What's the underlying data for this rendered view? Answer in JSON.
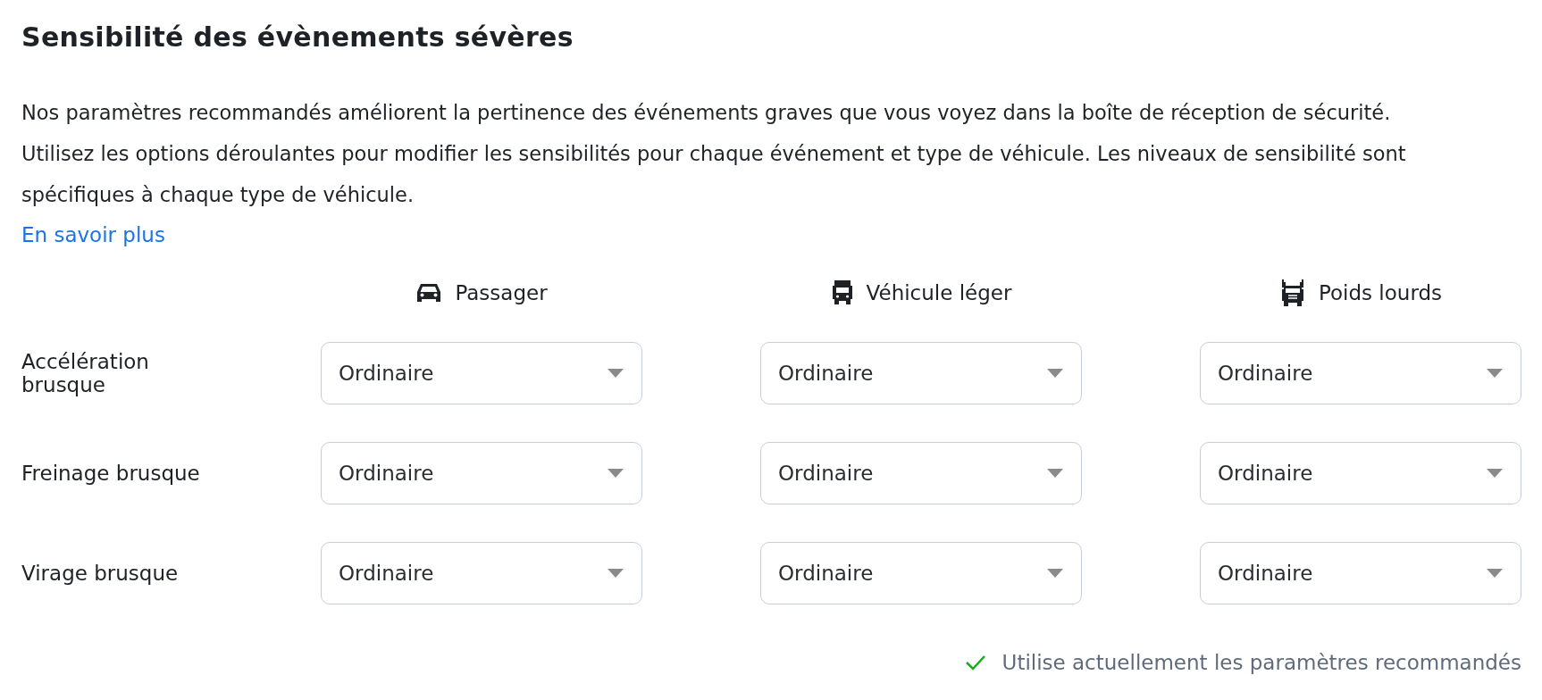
{
  "title": "Sensibilité des évènements sévères",
  "description": "Nos paramètres recommandés améliorent la pertinence des événements graves que vous voyez dans la boîte de réception de sécurité. Utilisez les options déroulantes pour modifier les sensibilités pour chaque événement et type de véhicule. Les niveaux de sensibilité sont spécifiques à chaque type de véhicule.",
  "link": "En savoir plus",
  "columns": [
    {
      "label": "Passager",
      "kind": "car"
    },
    {
      "label": "Véhicule léger",
      "kind": "van"
    },
    {
      "label": "Poids lourds",
      "kind": "truck"
    }
  ],
  "rows": [
    {
      "label": "Accélération brusque",
      "values": [
        "Ordinaire",
        "Ordinaire",
        "Ordinaire"
      ]
    },
    {
      "label": "Freinage brusque",
      "values": [
        "Ordinaire",
        "Ordinaire",
        "Ordinaire"
      ]
    },
    {
      "label": "Virage brusque",
      "values": [
        "Ordinaire",
        "Ordinaire",
        "Ordinaire"
      ]
    }
  ],
  "status": "Utilise actuellement les paramètres recommandés"
}
